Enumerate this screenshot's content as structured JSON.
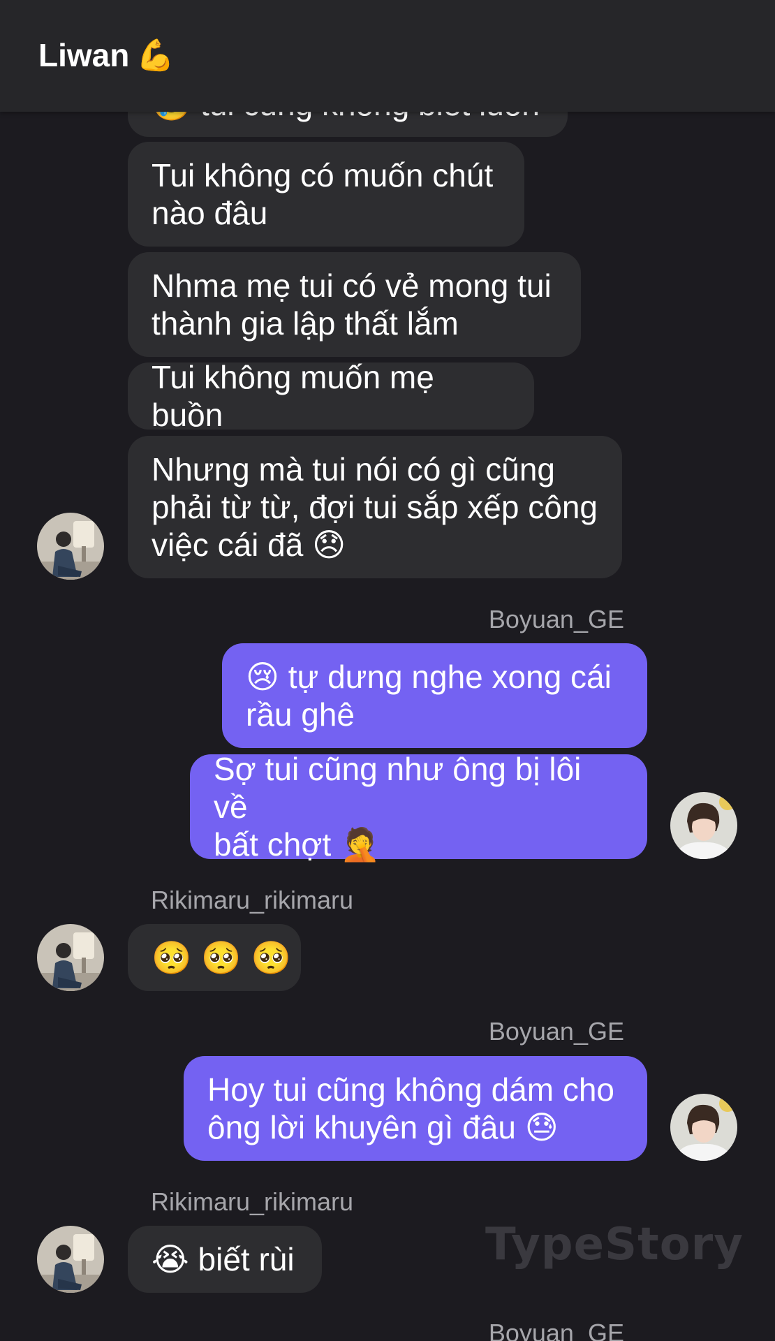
{
  "header": {
    "title": "Liwan",
    "title_emoji": "💪"
  },
  "messages": {
    "m0": {
      "text": "🥲 tui cũng không biết luôn"
    },
    "m1": {
      "text": "Tui không có muốn chút\nnào đâu"
    },
    "m2": {
      "text": "Nhma mẹ tui có vẻ mong tui\nthành gia lập thất lắm"
    },
    "m3": {
      "text": "Tui không muốn mẹ buồn"
    },
    "m4": {
      "text": "Nhưng mà tui nói có gì cũng\nphải từ từ, đợi tui sắp xếp công\nviệc cái đã 😞"
    },
    "sender1": "Boyuan_GE",
    "m5": {
      "text": "😢 tự dưng nghe xong cái\nrầu ghê"
    },
    "m6": {
      "text": "Sợ tui cũng như ông bị lôi về\nbất chợt 🤦"
    },
    "sender2": "Rikimaru_rikimaru",
    "m7": {
      "emojis": [
        "🥺",
        "🥺",
        "🥺"
      ]
    },
    "sender3": "Boyuan_GE",
    "m8": {
      "text": "Hoy tui cũng không dám cho\nông lời khuyên gì đâu 😓"
    },
    "sender4": "Rikimaru_rikimaru",
    "m9": {
      "text": "😭 biết rùi"
    },
    "sender5": "Boyuan_GE"
  },
  "watermark": "TypeStory",
  "colors": {
    "background": "#1c1b20",
    "header": "#262629",
    "incoming_bubble": "#2d2d30",
    "outgoing_bubble": "#7462f2",
    "sender_name": "#a6a6ab"
  }
}
